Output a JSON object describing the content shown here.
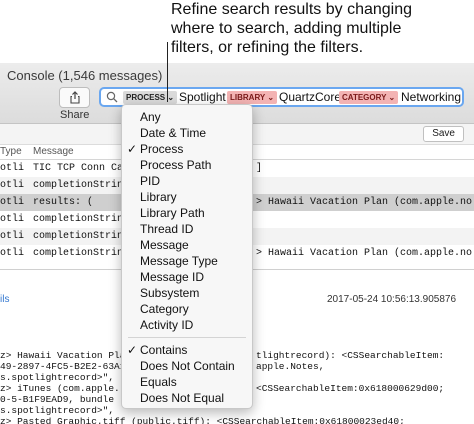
{
  "annotation": {
    "lines": [
      "Refine search results by changing",
      "where to search, adding multiple",
      "filters, or refining the filters."
    ]
  },
  "window": {
    "title": "Console (1,546 messages)",
    "share_label": "Share",
    "save_label": "Save"
  },
  "search": {
    "tokens": [
      {
        "key": "PROCESS",
        "value": "Spotlight"
      },
      {
        "key": "LIBRARY",
        "value": "QuartzCore"
      },
      {
        "key": "CATEGORY",
        "value": "Networking"
      }
    ]
  },
  "columns": {
    "type": "Type",
    "message": "Message"
  },
  "rows": [
    {
      "c1": "otli",
      "c2": "TIC TCP Conn Ca",
      "c3": "]"
    },
    {
      "c1": "otli",
      "c2": "completionStrin",
      "c3": ""
    },
    {
      "c1": "otli",
      "c2": "results: (",
      "c3": "> Hawaii Vacation Plan (com.apple.no"
    },
    {
      "c1": "otli",
      "c2": "completionStrin",
      "c3": ""
    },
    {
      "c1": "otli",
      "c2": "completionStrin",
      "c3": ""
    },
    {
      "c1": "otli",
      "c2": "completionStrin",
      "c3": "> Hawaii Vacation Plan (com.apple.no"
    }
  ],
  "detail": {
    "left": "ils",
    "timestamp": "2017-05-24 10:56:13.905876",
    "lines": [
      {
        "l": "z> Hawaii Vacation Pla",
        "r": "tlightrecord): <CSSearchableItem:"
      },
      {
        "l": "49-2897-4FC5-B2E2-63A1",
        "r": "apple.Notes,"
      },
      {
        "l": "s.spotlightrecord>\",",
        "r": ""
      },
      {
        "l": "z> iTunes (com.apple.",
        "r": "<CSSearchableItem:0x618000629d00;"
      },
      {
        "l": "0-5-B1F9EAD9, bundle",
        "r": ""
      },
      {
        "l": "s.spotlightrecord>\",",
        "r": ""
      },
      {
        "l": "z> Pasted Graphic.tiff (public.tiff): <CSSearchableItem:0x61800023ed40;",
        "r": ""
      }
    ]
  },
  "menu": {
    "where_items": [
      {
        "label": "Any",
        "checked": false
      },
      {
        "label": "Date & Time",
        "checked": false
      },
      {
        "label": "Process",
        "checked": true
      },
      {
        "label": "Process Path",
        "checked": false
      },
      {
        "label": "PID",
        "checked": false
      },
      {
        "label": "Library",
        "checked": false
      },
      {
        "label": "Library Path",
        "checked": false
      },
      {
        "label": "Thread ID",
        "checked": false
      },
      {
        "label": "Message",
        "checked": false
      },
      {
        "label": "Message Type",
        "checked": false
      },
      {
        "label": "Message ID",
        "checked": false
      },
      {
        "label": "Subsystem",
        "checked": false
      },
      {
        "label": "Category",
        "checked": false
      },
      {
        "label": "Activity ID",
        "checked": false
      }
    ],
    "match_items": [
      {
        "label": "Contains",
        "checked": true
      },
      {
        "label": "Does Not Contain",
        "checked": false
      },
      {
        "label": "Equals",
        "checked": false
      },
      {
        "label": "Does Not Equal",
        "checked": false
      }
    ],
    "check_glyph": "✓"
  },
  "colors": {
    "accent": "#6aa7f0",
    "token_red": "#f3b3b3"
  }
}
